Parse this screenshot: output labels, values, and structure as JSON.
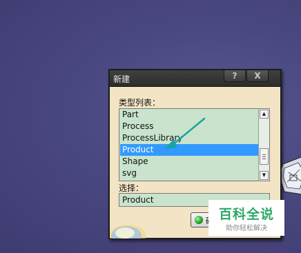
{
  "dialog": {
    "title": "新建",
    "help_button": "?",
    "close_button": "X",
    "list_label": "类型列表：",
    "items": [
      {
        "label": "Part",
        "selected": false
      },
      {
        "label": "Process",
        "selected": false
      },
      {
        "label": "ProcessLibrary",
        "selected": false
      },
      {
        "label": "Product",
        "selected": true
      },
      {
        "label": "Shape",
        "selected": false
      },
      {
        "label": "svg",
        "selected": false
      }
    ],
    "selection_label": "选择：",
    "selection_value": "Product",
    "ok_button": "确定"
  },
  "watermark": {
    "main": "百科全说",
    "sub": "助你轻松解决"
  },
  "colors": {
    "desktop": "#4a4880",
    "dialog_bg": "#f2e4c4",
    "list_bg": "#c9e3cc",
    "selection": "#3399ff",
    "annotation_arrow": "#1aa3a3",
    "watermark_green": "#2fa86a"
  },
  "icons": {
    "ok": "green-ball-icon",
    "annotation": "teal-arrow-icon"
  }
}
